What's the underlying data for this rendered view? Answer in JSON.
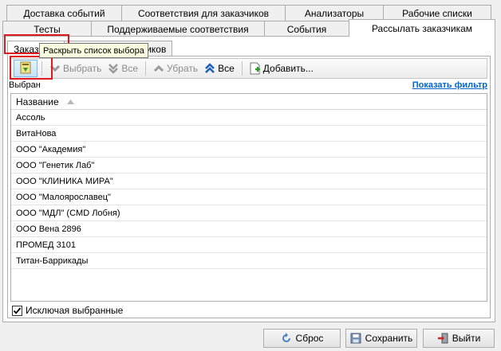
{
  "tabs_row1": [
    "Доставка событий",
    "Соответствия для заказчиков",
    "Анализаторы",
    "Рабочие списки"
  ],
  "tabs_row2": [
    "Тесты",
    "Поддерживаемые соответствия",
    "События",
    "Рассылать заказчикам"
  ],
  "active_tab": "Рассылать заказчикам",
  "subtabs": [
    "Заказчики",
    "Категории заказчиков"
  ],
  "active_subtab": "Заказчики",
  "toolbar": {
    "select": "Выбрать",
    "all1": "Все",
    "remove": "Убрать",
    "all2": "Все",
    "add": "Добавить..."
  },
  "selected_label": "Выбран",
  "tooltip": "Раскрыть список выбора",
  "filter_link": "Показать фильтр",
  "grid": {
    "column": "Название",
    "rows": [
      "Ассоль",
      "ВитаНова",
      "ООО \"Академия\"",
      "ООО \"Генетик Лаб\"",
      "ООО \"КЛИНИКА МИРА\"",
      "ООО \"Малоярославец\"",
      "ООО \"МДЛ\" (CMD Лобня)",
      "ООО Вена 2896",
      "ПРОМЕД 3101",
      "Титан-Баррикады"
    ]
  },
  "exclude_selected": {
    "label": "Исключая выбранные",
    "checked": true
  },
  "buttons": {
    "reset": "Сброс",
    "save": "Сохранить",
    "exit": "Выйти"
  },
  "colors": {
    "highlight": "#e0191e",
    "link": "#0066cc",
    "tooltip_bg": "#ffffe1"
  }
}
